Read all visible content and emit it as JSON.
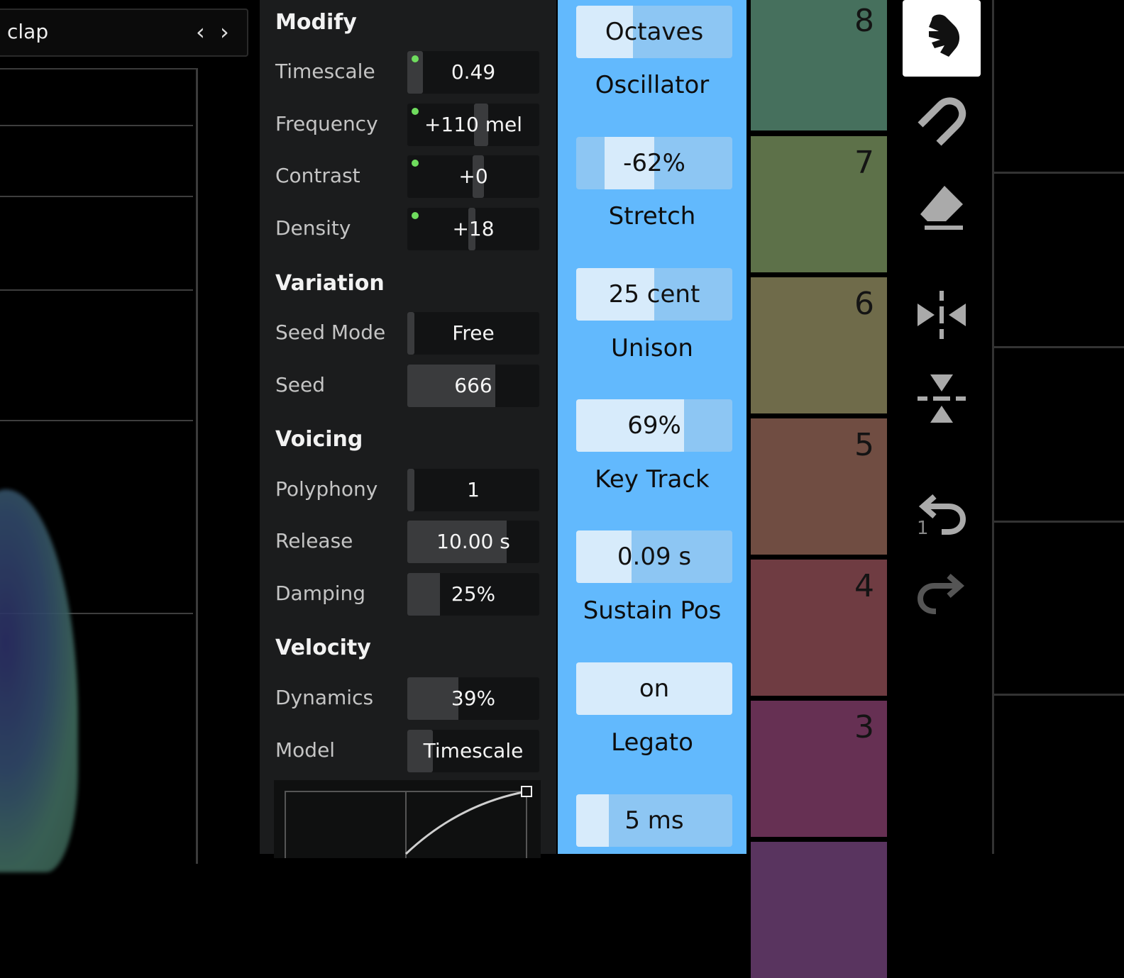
{
  "preset": {
    "name": "clap",
    "prev": "‹",
    "next": "›"
  },
  "modify": {
    "title": "Modify",
    "timescale": {
      "label": "Timescale",
      "value": "0.49"
    },
    "frequency": {
      "label": "Frequency",
      "value": "+110 mel"
    },
    "contrast": {
      "label": "Contrast",
      "value": "+0"
    },
    "density": {
      "label": "Density",
      "value": "+18"
    }
  },
  "variation": {
    "title": "Variation",
    "seed_mode": {
      "label": "Seed Mode",
      "value": "Free"
    },
    "seed": {
      "label": "Seed",
      "value": "666"
    }
  },
  "voicing": {
    "title": "Voicing",
    "polyphony": {
      "label": "Polyphony",
      "value": "1"
    },
    "release": {
      "label": "Release",
      "value": "10.00 s"
    },
    "damping": {
      "label": "Damping",
      "value": "25%"
    }
  },
  "velocity": {
    "title": "Velocity",
    "dynamics": {
      "label": "Dynamics",
      "value": "39%"
    },
    "model": {
      "label": "Model",
      "value": "Timescale"
    }
  },
  "oscillator": {
    "octaves": {
      "value": "Octaves",
      "label": "Oscillator"
    },
    "stretch": {
      "value": "-62%",
      "label": "Stretch"
    },
    "unison": {
      "value": "25 cent",
      "label": "Unison"
    },
    "key_track": {
      "value": "69%",
      "label": "Key Track"
    },
    "sustain_pos": {
      "value": "0.09 s",
      "label": "Sustain Pos"
    },
    "legato": {
      "value": "on",
      "label": "Legato"
    },
    "last": {
      "value": "5 ms"
    }
  },
  "swatches": [
    {
      "num": "8",
      "color": "#46705d"
    },
    {
      "num": "7",
      "color": "#5d7149"
    },
    {
      "num": "6",
      "color": "#6f6b4a"
    },
    {
      "num": "5",
      "color": "#704d42"
    },
    {
      "num": "4",
      "color": "#6f3c42"
    },
    {
      "num": "3",
      "color": "#663053"
    },
    {
      "num": "",
      "color": "#59345f"
    }
  ],
  "tools": {
    "undo_count": "1"
  },
  "colors": {
    "accent": "#62b9fd",
    "active_dot": "#6fdc5e",
    "panel": "#1b1c1d"
  }
}
